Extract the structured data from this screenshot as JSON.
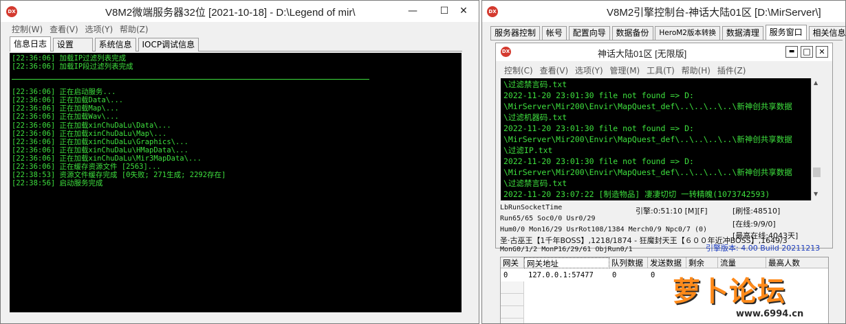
{
  "left_window": {
    "title": "V8M2微端服务器32位 [2021-10-18] - D:\\Legend of mir\\",
    "icon_text": "DX",
    "controls": {
      "minimize": "—",
      "maximize": "☐",
      "close": "✕"
    },
    "menu": [
      "控制(W)",
      "查看(V)",
      "选项(Y)",
      "帮助(Z)"
    ],
    "tabs": [
      "信息日志",
      "设置",
      "系统信息",
      "IOCP调试信息"
    ],
    "active_tab": 0,
    "log_top": [
      "[22:36:06] 加载IP过滤列表完成",
      "[22:36:06] 加载IP段过滤列表完成"
    ],
    "log_main": [
      "[22:36:06] 正在启动服务...",
      "[22:36:06] 正在加载Data\\...",
      "[22:36:06] 正在加载Map\\...",
      "[22:36:06] 正在加载Wav\\...",
      "[22:36:06] 正在加载xinChuDaLu\\Data\\...",
      "[22:36:06] 正在加载xinChuDaLu\\Map\\...",
      "[22:36:06] 正在加载xinChuDaLu\\Graphics\\...",
      "[22:36:06] 正在加载xinChuDaLu\\HMapData\\...",
      "[22:36:06] 正在加载xinChuDaLu\\Mir3MapData\\...",
      "[22:36:06] 正在缓存资源文件 [2563]...",
      "[22:38:53] 资源文件缓存完成 [0失败; 271生成; 2292存在]",
      "[22:38:56] 启动服务完成"
    ]
  },
  "right_window": {
    "title": "V8M2引擎控制台-神话大陆01区 [D:\\MirServer\\]",
    "controls": {
      "close": "✕"
    },
    "tabs": [
      "服务器控制",
      "帐号",
      "配置向导",
      "数据备份",
      "HeroM2版本转换",
      "数据清理",
      "服务窗口",
      "相关信息"
    ],
    "active_tab": 6,
    "inner": {
      "title": "神话大陆01区 [无限版]",
      "icon_text": "DX",
      "controls": {
        "minimize": "▬",
        "maximize": "□",
        "close": "✕"
      },
      "menu": [
        "控制(C)",
        "查看(V)",
        "选项(Y)",
        "管理(M)",
        "工具(T)",
        "帮助(H)",
        "插件(Z)"
      ],
      "log": [
        "\\过滤禁言码.txt",
        "2022-11-20 23:01:30 file not found => D:",
        "\\MirServer\\Mir200\\Envir\\MapQuest_def\\..\\..\\..\\..\\新神创共享数据",
        "\\过滤机器码.txt",
        "2022-11-20 23:01:30 file not found => D:",
        "\\MirServer\\Mir200\\Envir\\MapQuest_def\\..\\..\\..\\..\\新神创共享数据",
        "\\过滤IP.txt",
        "2022-11-20 23:01:30 file not found => D:",
        "\\MirServer\\Mir200\\Envir\\MapQuest_def\\..\\..\\..\\..\\新神创共享数据",
        "\\过滤禁言码.txt",
        "2022-11-20 23:07:22 [制造物品] 凄凄切切 一转精魄(1073742593)"
      ]
    },
    "stats": {
      "socket": "LbRunSocketTime",
      "engine": "引擎:0:51:10 [M][F]",
      "refresh": "[刷怪:48510]",
      "run": "Run65/65 Soc0/0 Usr0/29",
      "online": "[在线:9/9/0]",
      "hum": "Hum0/0 Mon16/29 UsrRot108/1384 Merch0/9 Npc0/7 (0)",
      "max_online": "[最高在线:4043天]",
      "boss": "圣·古巫王【1千年BOSS】,1218/1874 - 狂魔封天王【６００年近冲BOSS】,1649/3",
      "mon": "MonG0/1/2 MonP16/29/61 ObjRun0/1",
      "version": "引擎版本: 4.00 Build 20211213"
    },
    "grid": {
      "headers": [
        "网关",
        "网关地址",
        "队列数据",
        "发送数据",
        "剩余",
        "流量",
        "最高人数"
      ],
      "rows": [
        [
          "0",
          "127.0.0.1:57477",
          "0",
          "0"
        ]
      ]
    }
  },
  "watermark": {
    "text": "萝卜论坛",
    "url": "www.6994.cn"
  },
  "colors": {
    "console_bg": "#000000",
    "console_text": "#3ee03e",
    "app_icon": "#d43a2f",
    "version_text": "#1a3bbf",
    "watermark": "#ff8a1a"
  }
}
